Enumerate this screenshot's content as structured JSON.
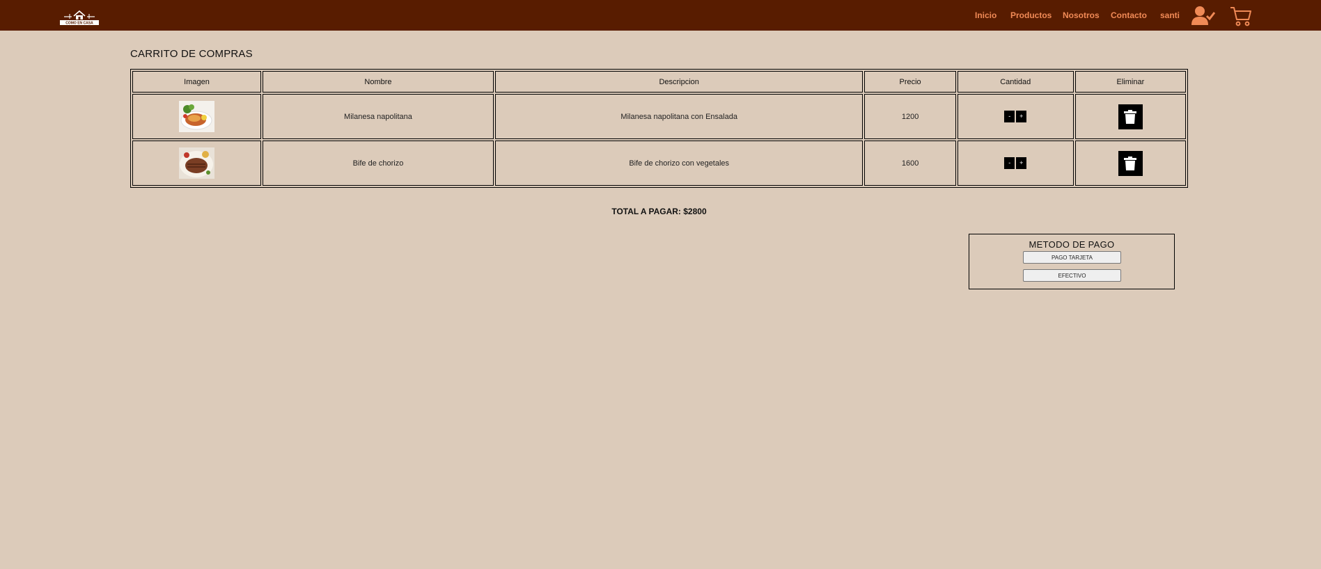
{
  "header": {
    "logo_text": "COMO EN CASA",
    "nav": [
      "Inicio",
      "Productos",
      "Nosotros",
      "Contacto"
    ],
    "user_name": "santi",
    "user_icon": "user-check-icon",
    "cart_icon": "shopping-cart-icon",
    "colors": {
      "bar": "#581c00",
      "link": "#f08a56"
    }
  },
  "page": {
    "title": "CARRITO DE COMPRAS",
    "background": "#dccbba"
  },
  "table": {
    "headers": [
      "Imagen",
      "Nombre",
      "Descripcion",
      "Precio",
      "Cantidad",
      "Eliminar"
    ],
    "rows": [
      {
        "image": "milanesa-photo",
        "name": "Milanesa napolitana",
        "description": "Milanesa napolitana con Ensalada",
        "price": "1200",
        "decrement": "-",
        "increment": "+",
        "delete_icon": "trash-icon"
      },
      {
        "image": "bife-photo",
        "name": "Bife de chorizo",
        "description": "Bife de chorizo con vegetales",
        "price": "1600",
        "decrement": "-",
        "increment": "+",
        "delete_icon": "trash-icon"
      }
    ]
  },
  "total": {
    "text": "TOTAL A PAGAR: $2800"
  },
  "payment": {
    "title": "METODO DE PAGO",
    "card_button": "PAGO TARJETA",
    "cash_button": "EFECTIVO"
  }
}
